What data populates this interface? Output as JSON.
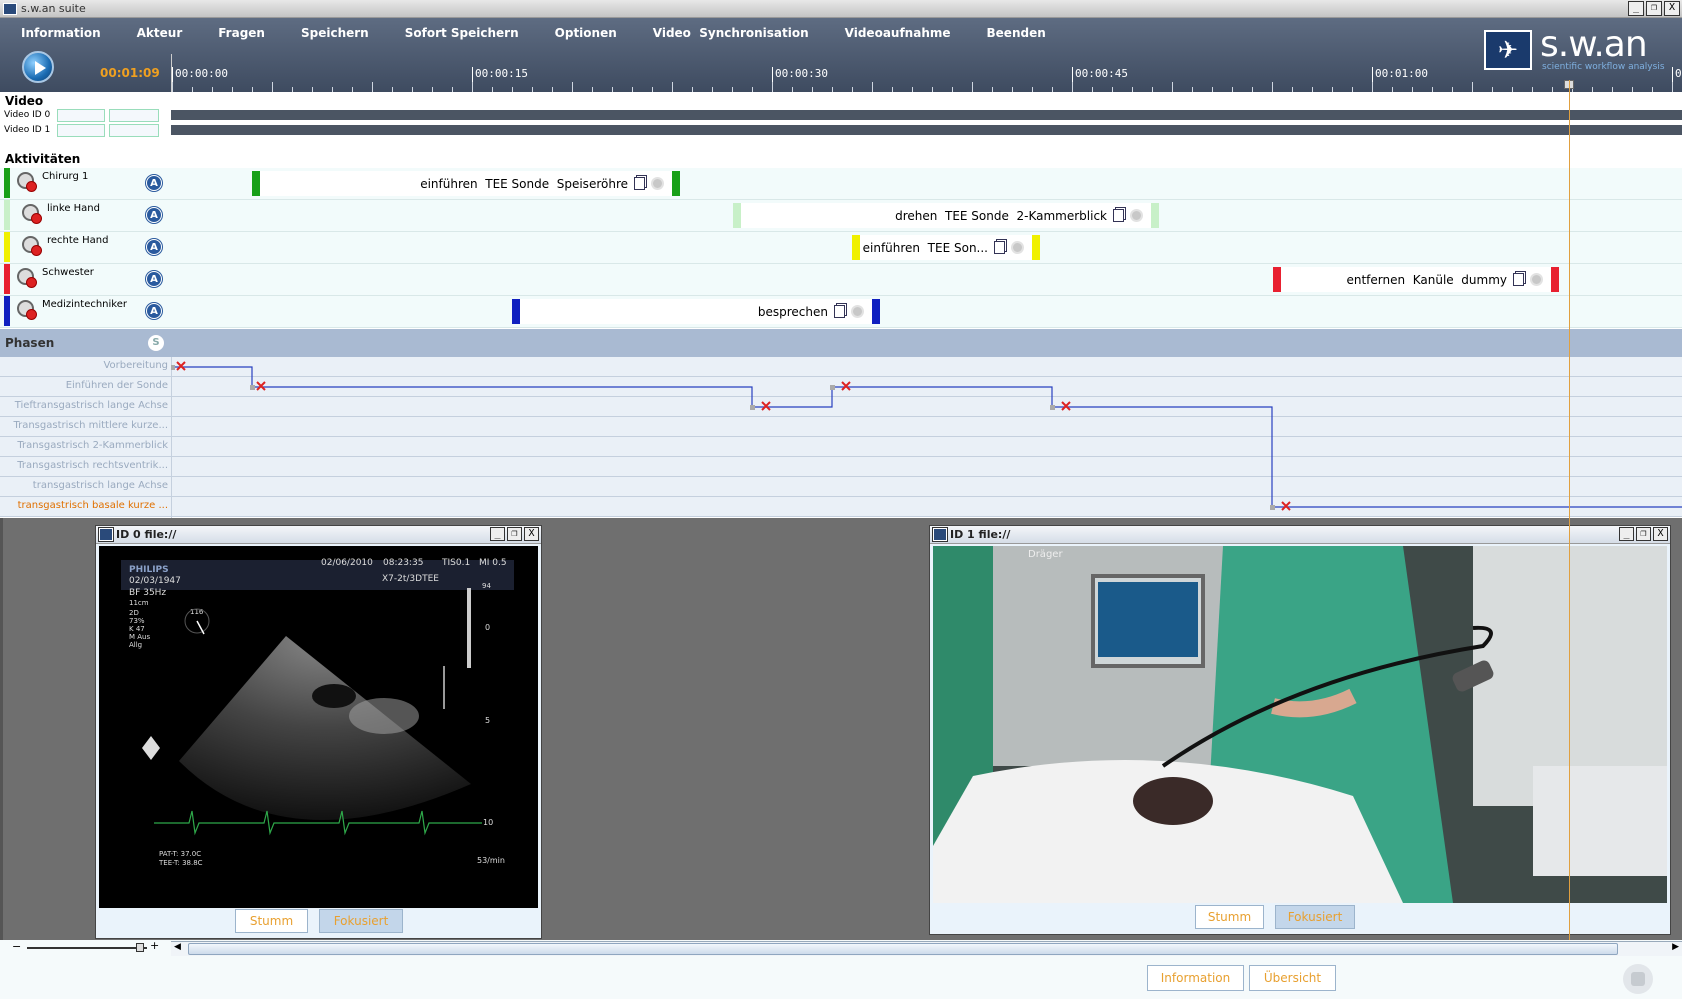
{
  "window": {
    "title": "s.w.an suite",
    "controls": [
      "_",
      "❐",
      "X"
    ]
  },
  "menu": [
    "Information",
    "Akteur",
    "Fragen",
    "Speichern",
    "Sofort Speichern",
    "Optionen",
    "Video  Synchronisation",
    "Videoaufnahme",
    "Beenden"
  ],
  "timecode": "00:01:09",
  "ruler": {
    "labels": [
      "00:00:00",
      "00:00:15",
      "00:00:30",
      "00:00:45",
      "00:01:00",
      "0"
    ]
  },
  "logo": {
    "name": "s.w.an",
    "tagline": "scientific workflow analysis"
  },
  "video": {
    "section_label": "Video",
    "rows": [
      {
        "label": "Video ID 0"
      },
      {
        "label": "Video ID 1"
      }
    ]
  },
  "activities": {
    "section_label": "Aktivitäten",
    "badge": "A",
    "actors": [
      {
        "name": "Chirurg 1",
        "color": "#18a018",
        "block_label": "einführen  TEE Sonde  Speiseröhre"
      },
      {
        "name": "linke Hand",
        "color": "#c8f0c8",
        "block_label": "drehen  TEE Sonde  2-Kammerblick"
      },
      {
        "name": "rechte Hand",
        "color": "#f0f000",
        "block_label": "einführen  TEE Son..."
      },
      {
        "name": "Schwester",
        "color": "#e82030",
        "block_label": "entfernen  Kanüle  dummy"
      },
      {
        "name": "Medizintechniker",
        "color": "#1020c0",
        "block_label": "besprechen"
      }
    ]
  },
  "phases": {
    "section_label": "Phasen",
    "badge": "S",
    "names": [
      "Vorbereitung",
      "Einführen der Sonde",
      "Tieftransgastrisch lange Achse",
      "Transgastrisch mittlere kurze...",
      "Transgastrisch 2-Kammerblick",
      "Transgastrisch rechtsventrik...",
      "transgastrisch lange Achse",
      "transgastrisch basale kurze ..."
    ],
    "active_color": "#e07000",
    "line_color": "#2840c0"
  },
  "video_windows": [
    {
      "title": "ID 0 file://",
      "mute_label": "Stumm",
      "focus_label": "Fokusiert",
      "us": {
        "brand": "PHILIPS",
        "date": "02/06/2010",
        "time": "08:23:35",
        "tis": "TIS0.1",
        "mi": "MI 0.5",
        "dob": "02/03/1947",
        "probe": "X7-2t/3DTEE",
        "bf": "BF 35Hz",
        "depth": "11cm",
        "mode": "2D",
        "gain": "73%",
        "k": "K 47",
        "maus": "M Aus",
        "allg": "Allg",
        "scale_top": "94",
        "scale_0": "0",
        "scale_5": "5",
        "scale_10": "10",
        "pat": "PAT-T: 37.0C",
        "tee": "TEE-T: 38.8C",
        "hr": "53/min",
        "angle": "116"
      }
    },
    {
      "title": "ID 1 file://",
      "mute_label": "Stumm",
      "focus_label": "Fokusiert",
      "scene_text": "Dräger"
    }
  ],
  "bottom": {
    "zoom_minus": "−",
    "zoom_plus": "+",
    "info_button": "Information",
    "overview_button": "Übersicht",
    "scroll_left": "◀",
    "scroll_right": "▶"
  }
}
